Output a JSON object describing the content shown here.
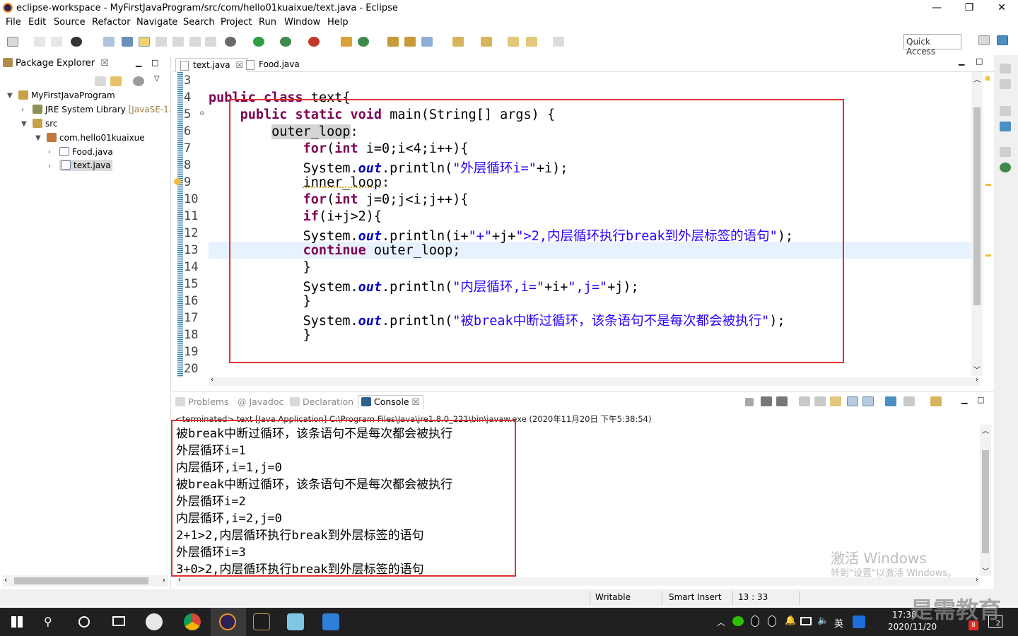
{
  "window": {
    "title": "eclipse-workspace - MyFirstJavaProgram/src/com/hello01kuaixue/text.java - Eclipse",
    "minimize": "—",
    "maximize": "❐",
    "close": "✕"
  },
  "menu": [
    "File",
    "Edit",
    "Source",
    "Refactor",
    "Navigate",
    "Search",
    "Project",
    "Run",
    "Window",
    "Help"
  ],
  "toolbar": {
    "quick_access": "Quick Access"
  },
  "package_explorer": {
    "tab_label": "Package Explorer",
    "tab_close": "☒",
    "tree": [
      {
        "label": "MyFirstJavaProgram",
        "icon": "project-icon"
      },
      {
        "label": "JRE System Library",
        "suffix": "[JavaSE-1.",
        "icon": "library-icon"
      },
      {
        "label": "src",
        "icon": "source-folder-icon"
      },
      {
        "label": "com.hello01kuaixue",
        "icon": "package-icon"
      },
      {
        "label": "Food.java",
        "icon": "java-file-icon"
      },
      {
        "label": "text.java",
        "icon": "java-file-icon"
      }
    ]
  },
  "editor": {
    "tabs": [
      {
        "label": "text.java",
        "close": "☒"
      },
      {
        "label": "Food.java"
      }
    ],
    "line_numbers": [
      "3",
      "4",
      "5",
      "6",
      "7",
      "8",
      "9",
      "10",
      "11",
      "12",
      "13",
      "14",
      "15",
      "16",
      "17",
      "18",
      "19",
      "20"
    ]
  },
  "console": {
    "tabs": [
      "Problems",
      "Javadoc",
      "Declaration",
      "Console"
    ],
    "console_close": "☒",
    "terminated": "<terminated> text [Java Application] C:\\Program Files\\Java\\jre1.8.0_221\\bin\\javaw.exe (2020年11月20日 下午5:38:54)",
    "output": [
      "被break中断过循环，该条语句不是每次都会被执行",
      "外层循环i=1",
      "内层循环,i=1,j=0",
      "被break中断过循环，该条语句不是每次都会被执行",
      "外层循环i=2",
      "内层循环,i=2,j=0",
      "2+1>2,内层循环执行break到外层标签的语句",
      "外层循环i=3",
      "3+0>2,内层循环执行break到外层标签的语句"
    ]
  },
  "status": {
    "writable": "Writable",
    "insert_mode": "Smart Insert",
    "position": "13 : 33"
  },
  "taskbar": {
    "ime": "英",
    "time": "17:38",
    "date": "2020/11/20",
    "notification_count": "2",
    "badge": "8"
  },
  "watermarks": {
    "activate_title": "激活 Windows",
    "activate_sub": "转到\"设置\"以激活 Windows。",
    "brand": "是需教育"
  }
}
